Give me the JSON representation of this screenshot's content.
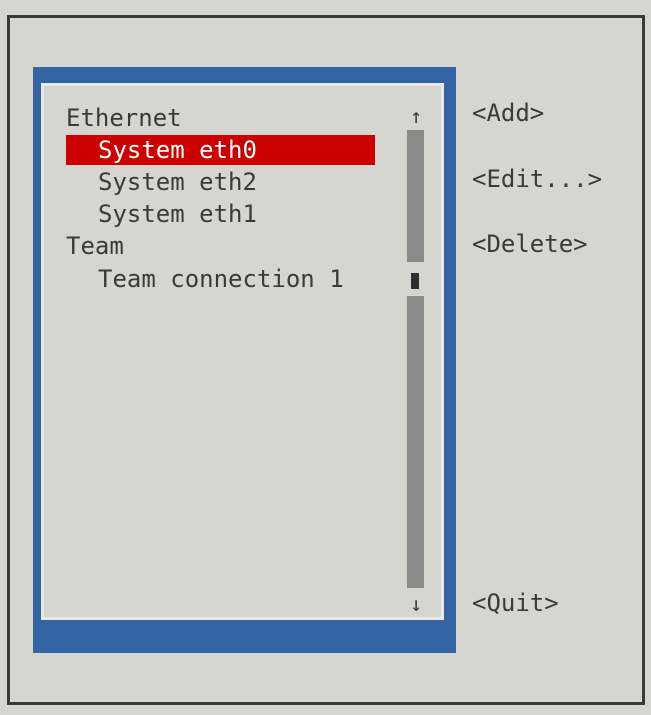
{
  "connections": {
    "groups": [
      {
        "label": "Ethernet",
        "items": [
          {
            "label": "System eth0",
            "selected": true
          },
          {
            "label": "System eth2",
            "selected": false
          },
          {
            "label": "System eth1",
            "selected": false
          }
        ]
      },
      {
        "label": "Team",
        "items": [
          {
            "label": "Team connection 1",
            "selected": false
          }
        ]
      }
    ]
  },
  "scrollbar": {
    "up_arrow": "↑",
    "down_arrow": "↓"
  },
  "actions": {
    "add_label": "<Add>",
    "edit_label": "<Edit...>",
    "delete_label": "<Delete>",
    "quit_label": "<Quit>"
  },
  "colors": {
    "background": "#d6d6d0",
    "panel_blue": "#3464a4",
    "selection_red": "#cc0000",
    "text": "#3a3a3a"
  }
}
